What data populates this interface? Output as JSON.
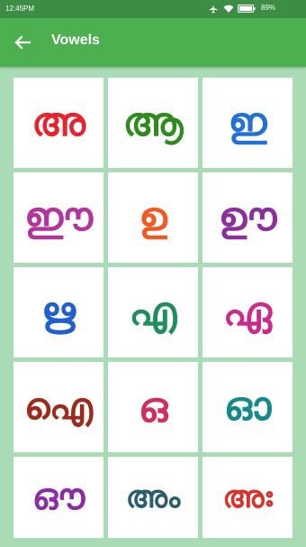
{
  "status_bar": {
    "time": "12:45PM",
    "battery": "89%",
    "icons": [
      "airplane-mode-icon",
      "wifi-icon",
      "battery-icon"
    ]
  },
  "toolbar": {
    "back_icon": "arrow-back-icon",
    "title": "Vowels",
    "color": "#4caf50"
  },
  "vowels": [
    {
      "letter": "അ",
      "color": "#e8232f"
    },
    {
      "letter": "ആ",
      "color": "#2e8b1e"
    },
    {
      "letter": "ഇ",
      "color": "#2471d6"
    },
    {
      "letter": "ഈ",
      "color": "#b4349e"
    },
    {
      "letter": "ഉ",
      "color": "#f05a22"
    },
    {
      "letter": "ഊ",
      "color": "#8b2f9c"
    },
    {
      "letter": "ഋ",
      "color": "#1f5fcf"
    },
    {
      "letter": "എ",
      "color": "#1e8e5a"
    },
    {
      "letter": "ഏ",
      "color": "#cc2a8a"
    },
    {
      "letter": "ഐ",
      "color": "#9e2a1c"
    },
    {
      "letter": "ഒ",
      "color": "#d12d5e"
    },
    {
      "letter": "ഓ",
      "color": "#138a8a"
    },
    {
      "letter": "ഔ",
      "color": "#8d2aa6"
    },
    {
      "letter": "അം",
      "color": "#2a5e6e"
    },
    {
      "letter": "അഃ",
      "color": "#d9322a"
    }
  ]
}
